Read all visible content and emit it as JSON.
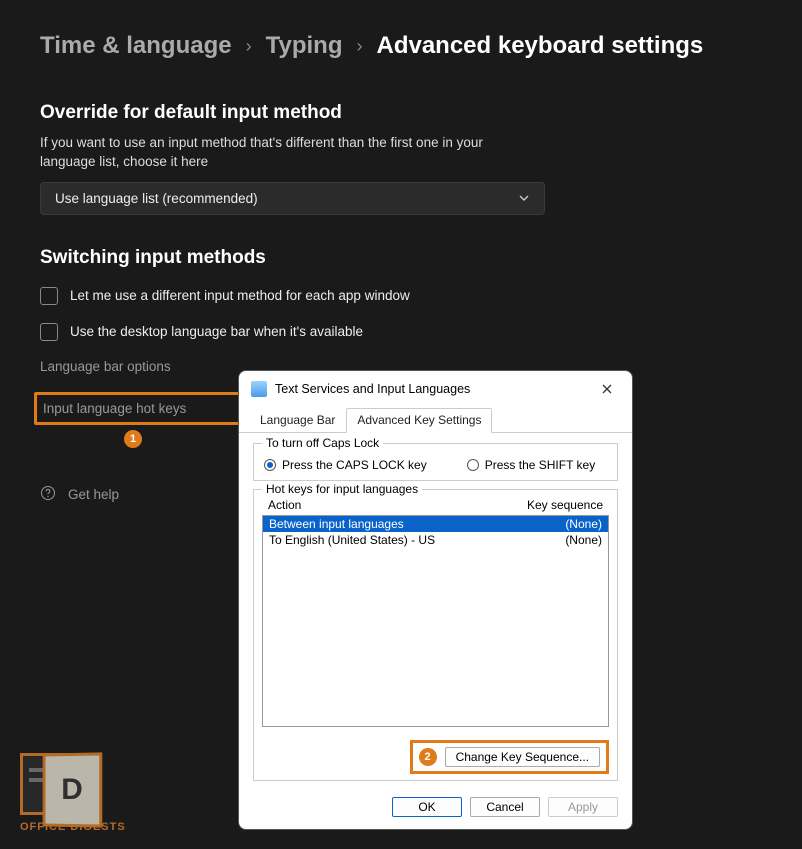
{
  "breadcrumb": {
    "level1": "Time & language",
    "level2": "Typing",
    "level3": "Advanced keyboard settings"
  },
  "sections": {
    "override_title": "Override for default input method",
    "override_desc": "If you want to use an input method that's different than the first one in your language list, choose it here",
    "dropdown_value": "Use language list (recommended)",
    "switching_title": "Switching input methods",
    "check1": "Let me use a different input method for each app window",
    "check2": "Use the desktop language bar when it's available",
    "link_langbar": "Language bar options",
    "link_hotkeys": "Input language hot keys",
    "help": "Get help"
  },
  "callouts": {
    "one": "1",
    "two": "2"
  },
  "dialog": {
    "title": "Text Services and Input Languages",
    "tabs": {
      "langbar": "Language Bar",
      "advanced": "Advanced Key Settings"
    },
    "caps_group": "To turn off Caps Lock",
    "radio_caps": "Press the CAPS LOCK key",
    "radio_shift": "Press the SHIFT key",
    "hotkeys_group": "Hot keys for input languages",
    "col_action": "Action",
    "col_keyseq": "Key sequence",
    "rows": [
      {
        "action": "Between input languages",
        "seq": "(None)",
        "selected": true
      },
      {
        "action": "To English (United States) - US",
        "seq": "(None)",
        "selected": false
      }
    ],
    "change_btn": "Change Key Sequence...",
    "ok": "OK",
    "cancel": "Cancel",
    "apply": "Apply"
  },
  "watermark": {
    "letter": "D",
    "text": "OFFICE DIGESTS"
  }
}
